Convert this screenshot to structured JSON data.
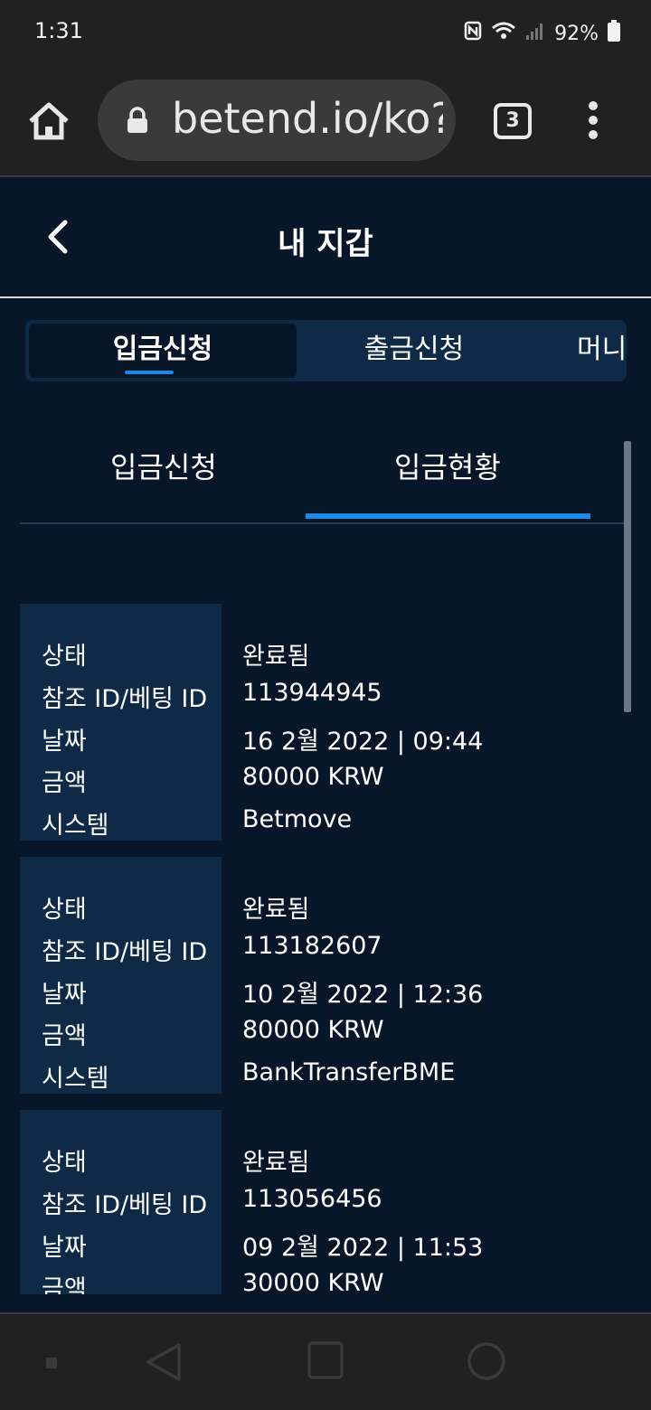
{
  "status_bar": {
    "time": "1:31",
    "battery": "92%",
    "icons": [
      "nfc-icon",
      "wifi-icon",
      "signal-icon",
      "battery-icon"
    ]
  },
  "browser": {
    "url": "betend.io/ko?b",
    "tab_count": "3",
    "icons": [
      "home-icon",
      "lock-icon",
      "tabs-icon",
      "more-icon"
    ]
  },
  "header": {
    "title": "내 지갑",
    "back_icon": "chevron-left-icon"
  },
  "main_tabs": [
    {
      "label": "입금신청",
      "active": true
    },
    {
      "label": "출금신청",
      "active": false
    },
    {
      "label": "머니",
      "active": false
    }
  ],
  "sub_tabs": [
    {
      "label": "입금신청",
      "active": false
    },
    {
      "label": "입금현황",
      "active": true
    }
  ],
  "field_labels": {
    "status": "상태",
    "ref_id": "참조 ID/베팅 ID",
    "date": "날짜",
    "amount": "금액",
    "system": "시스템"
  },
  "records": [
    {
      "status": "완료됨",
      "ref_id": "113944945",
      "date": "16 2월 2022 | 09:44",
      "amount": "80000 KRW",
      "system": "Betmove"
    },
    {
      "status": "완료됨",
      "ref_id": "113182607",
      "date": "10 2월 2022 | 12:36",
      "amount": "80000 KRW",
      "system": "BankTransferBME"
    },
    {
      "status": "완료됨",
      "ref_id": "113056456",
      "date": "09 2월 2022 | 11:53",
      "amount": "30000 KRW",
      "system": ""
    }
  ],
  "colors": {
    "background": "#071629",
    "panel": "#0e2a46",
    "accent": "#1e88e5",
    "chrome": "#212121"
  },
  "nav_icons": [
    "recents-dot-icon",
    "back-triangle-icon",
    "home-square-icon",
    "assistant-circle-icon"
  ]
}
